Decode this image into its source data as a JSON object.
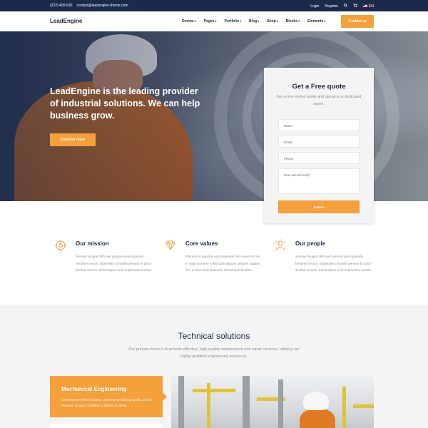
{
  "topbar": {
    "phone": "(222) 400-630",
    "email": "contact@leadengine-theme.com",
    "login": "Login",
    "register": "Register",
    "language": "EN"
  },
  "nav": {
    "logo": "LeadEngine",
    "items": [
      "Demos",
      "Pages",
      "Portfolio",
      "Blog",
      "Shop",
      "Blocks",
      "Elements"
    ],
    "contact_button": "Contact us"
  },
  "hero": {
    "headline": "LeadEngine is the leading provider of industrial solutions. We can help business grow.",
    "button": "Discover more"
  },
  "quote_form": {
    "title": "Get a Free quote",
    "subtitle": "Get a free online quote and speak to a dedicated agent.",
    "name_placeholder": "Name",
    "email_placeholder": "Email",
    "phone_placeholder": "Phone",
    "message_placeholder": "How can we help?",
    "submit": "Submit"
  },
  "features": [
    {
      "title": "Our mission",
      "icon": "target-icon",
      "text": "Semper feugiat nibh sed pulvinar proin gravida hendrerit lectus. Dignissim convallis aenean et tortor at risus viverra. Sed tempus urna et pharetra massa."
    },
    {
      "title": "Core values",
      "icon": "diamond-icon",
      "text": "Placerat in egestas erat imperdiet sed euismod nisi. In nulla posuere sollicitudin aliquam ultrices sagittis orci a. Non enim praesent elementum facilisis."
    },
    {
      "title": "Our people",
      "icon": "people-icon",
      "text": "Semper feugiat nibh sed pulvinar proin gravida hendrerit lectus. Dignissim convallis aenean et tortor at risus viverra. Sed tempus urna et pharetra massa."
    }
  ],
  "tech": {
    "title": "Technical solutions",
    "description": "Our primary focus is to provide effective, high quality maintenance and repair services, utilising our highly qualified engineering resources.",
    "card_title": "Mechanical Engineering",
    "card_text": "Lorem ipsum dolor sit amet, consectetur adipiscing elit, sed do eiusmod tempor incididunt ut labore et dolore"
  },
  "colors": {
    "accent": "#f5a03a",
    "navy": "#1b2a4a",
    "muted": "#8a8f99"
  }
}
